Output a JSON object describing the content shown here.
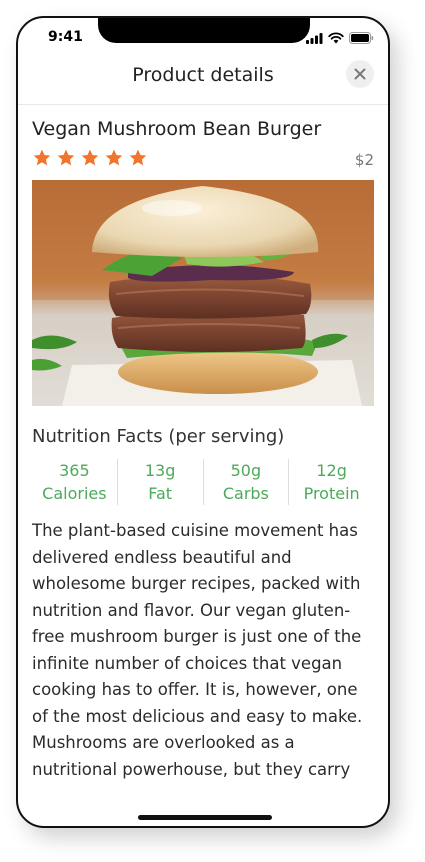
{
  "status_bar": {
    "time": "9:41"
  },
  "header": {
    "title": "Product details"
  },
  "product": {
    "title": "Vegan Mushroom Bean Burger",
    "rating": 5,
    "price": "$2"
  },
  "nutrition": {
    "title": "Nutrition Facts (per serving)",
    "items": [
      {
        "value": "365",
        "label": "Calories"
      },
      {
        "value": "13g",
        "label": "Fat"
      },
      {
        "value": "50g",
        "label": "Carbs"
      },
      {
        "value": "12g",
        "label": "Protein"
      }
    ]
  },
  "description": "The plant-based cuisine movement has delivered endless beautiful and wholesome burger recipes, packed with nutrition and flavor. Our vegan gluten-free mushroom burger is just one of the infinite number of choices that vegan cooking has to offer. It is, however, one of the most delicious and easy to make. Mushrooms are overlooked as a nutritional powerhouse, but they carry",
  "colors": {
    "star": "#f2742a",
    "nutrition": "#4caa5a"
  }
}
